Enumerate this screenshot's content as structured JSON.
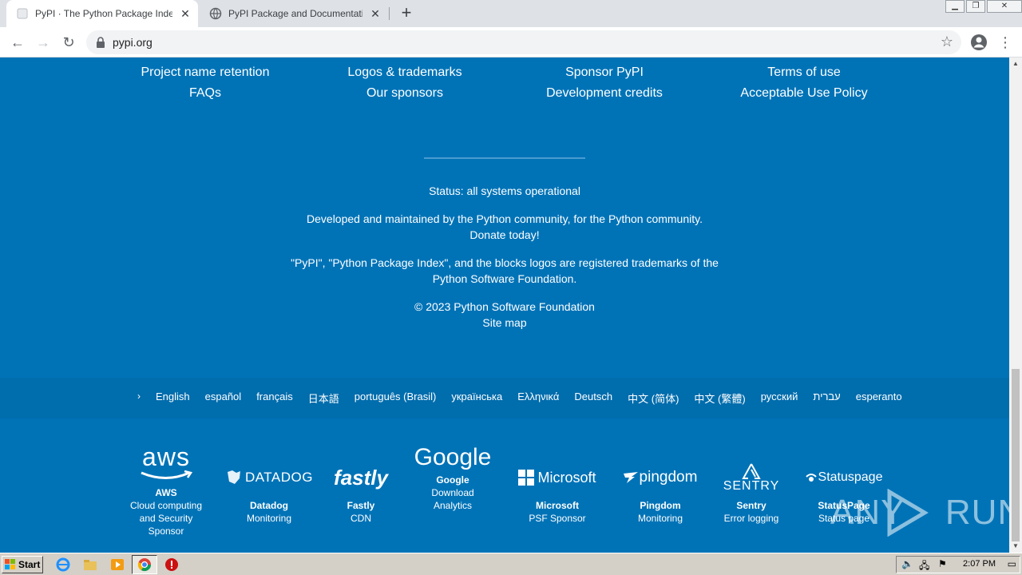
{
  "browser": {
    "tabs": [
      {
        "title": "PyPI · The Python Package Index",
        "active": true
      },
      {
        "title": "PyPI Package and Documentation St",
        "active": false
      }
    ],
    "url": "pypi.org"
  },
  "footer": {
    "columns": [
      {
        "links": [
          "Project name retention",
          "FAQs"
        ]
      },
      {
        "links": [
          "Logos & trademarks",
          "Our sponsors"
        ]
      },
      {
        "links": [
          "Sponsor PyPI",
          "Development credits"
        ]
      },
      {
        "links": [
          "Terms of use",
          "Acceptable Use Policy"
        ]
      }
    ],
    "status": "Status: all systems operational",
    "developed": "Developed and maintained by the Python community, for the Python community.",
    "donate": "Donate today!",
    "trademark_line1": "\"PyPI\", \"Python Package Index\", and the blocks logos are registered trademarks of the",
    "trademark_line2": "Python Software Foundation.",
    "copyright": "© 2023 Python Software Foundation",
    "sitemap": "Site map"
  },
  "languages": [
    "English",
    "español",
    "français",
    "日本語",
    "português (Brasil)",
    "українська",
    "Ελληνικά",
    "Deutsch",
    "中文 (简体)",
    "中文 (繁體)",
    "русский",
    "עברית",
    "esperanto"
  ],
  "sponsors": [
    {
      "logo_text": "aws",
      "name": "AWS",
      "desc": [
        "Cloud computing",
        "and Security",
        "Sponsor"
      ]
    },
    {
      "logo_text": "DATADOG",
      "name": "Datadog",
      "desc": [
        "Monitoring"
      ]
    },
    {
      "logo_text": "fastly",
      "name": "Fastly",
      "desc": [
        "CDN"
      ]
    },
    {
      "logo_text": "Google",
      "name": "Google",
      "desc": [
        "Download",
        "Analytics"
      ]
    },
    {
      "logo_text": "Microsoft",
      "name": "Microsoft",
      "desc": [
        "PSF Sponsor"
      ]
    },
    {
      "logo_text": "pingdom",
      "name": "Pingdom",
      "desc": [
        "Monitoring"
      ]
    },
    {
      "logo_text": "SENTRY",
      "name": "Sentry",
      "desc": [
        "Error logging"
      ]
    },
    {
      "logo_text": "Statuspage",
      "name": "StatusPage",
      "desc": [
        "Status page"
      ]
    }
  ],
  "watermark": "ANY RUN",
  "taskbar": {
    "start": "Start",
    "clock": "2:07 PM"
  },
  "colors": {
    "page_bg": "#0073b7",
    "lang_bar_bg": "#006dad",
    "text": "#ffffff"
  }
}
